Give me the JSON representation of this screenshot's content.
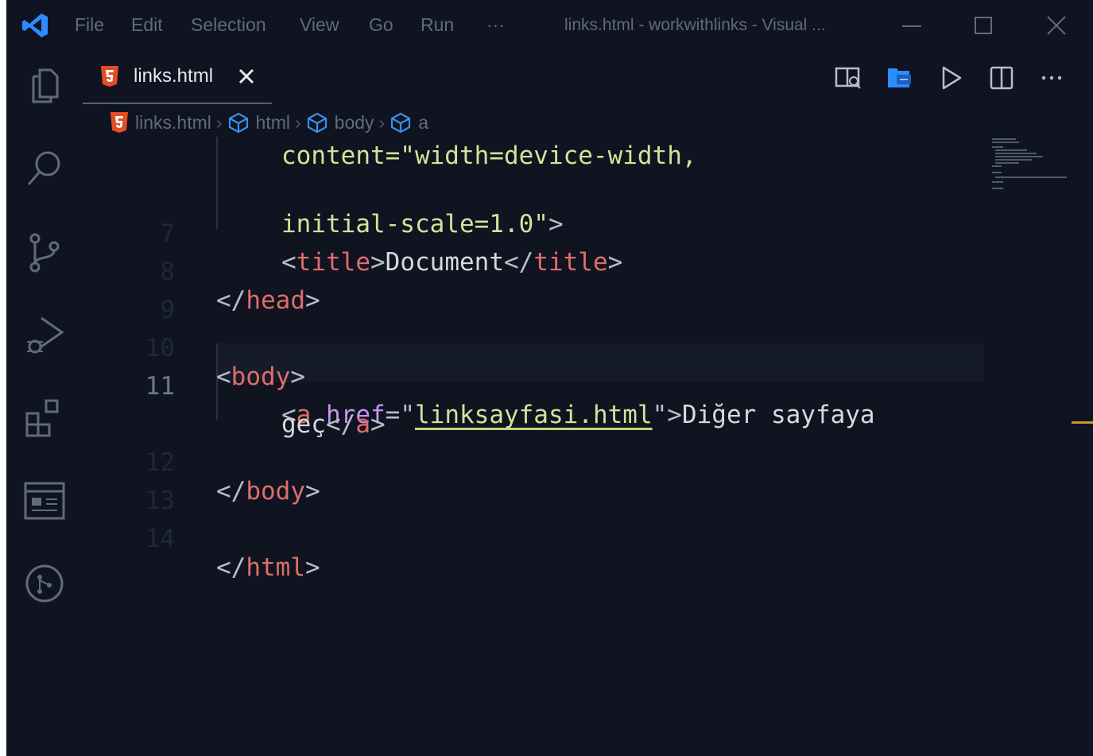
{
  "menu": [
    "File",
    "Edit",
    "Selection",
    "View",
    "Go",
    "Run",
    "···"
  ],
  "window_title": "links.html - workwithlinks - Visual ...",
  "tab": {
    "label": "links.html"
  },
  "breadcrumb": [
    "links.html",
    "html",
    "body",
    "a"
  ],
  "editor": {
    "lines": [
      {
        "num": "",
        "text": "content=\"width=device-width,",
        "partial": true
      },
      {
        "num": "",
        "text": "initial-scale=1.0\">"
      },
      {
        "num": "7",
        "text": "<title>Document</title>"
      },
      {
        "num": "8",
        "text": "</head>"
      },
      {
        "num": "9",
        "text": ""
      },
      {
        "num": "10",
        "text": "<body>"
      },
      {
        "num": "11",
        "text": "<a href=\"linksayfasi.html\">Diğer sayfaya"
      },
      {
        "num": "",
        "text": "geç</a>"
      },
      {
        "num": "12",
        "text": "</body>"
      },
      {
        "num": "13",
        "text": ""
      },
      {
        "num": "14",
        "text": "</html>"
      }
    ],
    "active_line": "11"
  },
  "tokens": {
    "l1_str": "initial-scale=1.0\"",
    "l1_end": ">",
    "l7_open_lt": "<",
    "l7_open_tag": "title",
    "l7_open_gt": ">",
    "l7_text": "Document",
    "l7_close_lt": "</",
    "l7_close_tag": "title",
    "l7_close_gt": ">",
    "l8_lt": "</",
    "l8_tag": "head",
    "l8_gt": ">",
    "l10_lt": "<",
    "l10_tag": "body",
    "l10_gt": ">",
    "l11_lt": "<",
    "l11_tag": "a",
    "l11_attr": " href",
    "l11_eq": "=\"",
    "l11_val": "linksayfasi.html",
    "l11_q": "\"",
    "l11_gt": ">",
    "l11_text": "Diğer sayfaya",
    "l11b_text": "geç",
    "l11b_lt": "</",
    "l11b_tag": "a",
    "l11b_gt": ">",
    "l12_lt": "</",
    "l12_tag": "body",
    "l12_gt": ">",
    "l14_lt": "</",
    "l14_tag": "html",
    "l14_gt": ">"
  },
  "colors": {
    "background": "#0f1420",
    "tag": "#e06c6c",
    "attribute": "#c792ea",
    "string": "#d6e09a",
    "accent_blue": "#2b8cff",
    "html_icon": "#e44d26",
    "scroll_marker": "#c59a2a"
  },
  "icons": {
    "activity": [
      "explorer-icon",
      "search-icon",
      "source-control-icon",
      "run-debug-icon",
      "extensions-icon",
      "browser-preview-icon",
      "git-graph-icon"
    ],
    "toolbar": [
      "open-preview-icon",
      "open-in-browser-icon",
      "run-icon",
      "split-editor-icon",
      "more-actions-icon"
    ]
  }
}
